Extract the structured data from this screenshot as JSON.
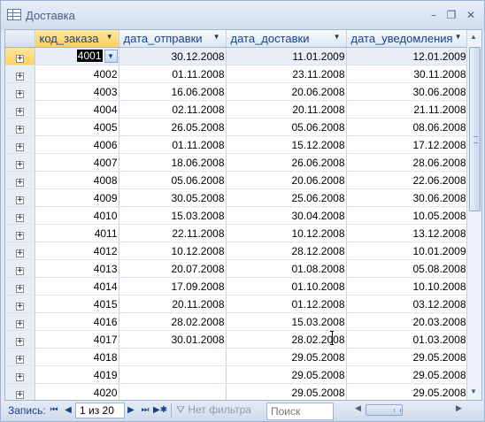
{
  "window": {
    "title": "Доставка",
    "buttons": {
      "minimize": "–",
      "restore": "❐",
      "close": "✕"
    }
  },
  "table": {
    "columns": [
      "код_заказа",
      "дата_отправки",
      "дата_доставки",
      "дата_уведомления"
    ],
    "rows": [
      {
        "id": "4001",
        "sent": "30.12.2008",
        "delivered": "11.01.2009",
        "notified": "12.01.2009"
      },
      {
        "id": "4002",
        "sent": "01.11.2008",
        "delivered": "23.11.2008",
        "notified": "30.11.2008"
      },
      {
        "id": "4003",
        "sent": "16.06.2008",
        "delivered": "20.06.2008",
        "notified": "30.06.2008"
      },
      {
        "id": "4004",
        "sent": "02.11.2008",
        "delivered": "20.11.2008",
        "notified": "21.11.2008"
      },
      {
        "id": "4005",
        "sent": "26.05.2008",
        "delivered": "05.06.2008",
        "notified": "08.06.2008"
      },
      {
        "id": "4006",
        "sent": "01.11.2008",
        "delivered": "15.12.2008",
        "notified": "17.12.2008"
      },
      {
        "id": "4007",
        "sent": "18.06.2008",
        "delivered": "26.06.2008",
        "notified": "28.06.2008"
      },
      {
        "id": "4008",
        "sent": "05.06.2008",
        "delivered": "20.06.2008",
        "notified": "22.06.2008"
      },
      {
        "id": "4009",
        "sent": "30.05.2008",
        "delivered": "25.06.2008",
        "notified": "30.06.2008"
      },
      {
        "id": "4010",
        "sent": "15.03.2008",
        "delivered": "30.04.2008",
        "notified": "10.05.2008"
      },
      {
        "id": "4011",
        "sent": "22.11.2008",
        "delivered": "10.12.2008",
        "notified": "13.12.2008"
      },
      {
        "id": "4012",
        "sent": "10.12.2008",
        "delivered": "28.12.2008",
        "notified": "10.01.2009"
      },
      {
        "id": "4013",
        "sent": "20.07.2008",
        "delivered": "01.08.2008",
        "notified": "05.08.2008"
      },
      {
        "id": "4014",
        "sent": "17.09.2008",
        "delivered": "01.10.2008",
        "notified": "10.10.2008"
      },
      {
        "id": "4015",
        "sent": "20.11.2008",
        "delivered": "01.12.2008",
        "notified": "03.12.2008"
      },
      {
        "id": "4016",
        "sent": "28.02.2008",
        "delivered": "15.03.2008",
        "notified": "20.03.2008"
      },
      {
        "id": "4017",
        "sent": "30.01.2008",
        "delivered": "28.02.2008",
        "notified": "01.03.2008"
      },
      {
        "id": "4018",
        "sent": "",
        "delivered": "29.05.2008",
        "notified": "29.05.2008"
      },
      {
        "id": "4019",
        "sent": "",
        "delivered": "29.05.2008",
        "notified": "29.05.2008"
      },
      {
        "id": "4020",
        "sent": "",
        "delivered": "29.05.2008",
        "notified": "29.05.2008"
      }
    ]
  },
  "navigation": {
    "label": "Запись:",
    "first": "⏮",
    "prev": "◀",
    "counter": "1 из 20",
    "next": "▶",
    "last": "⏭",
    "new": "▶✱",
    "filter": "Нет фильтра",
    "search_placeholder": "Поиск"
  }
}
